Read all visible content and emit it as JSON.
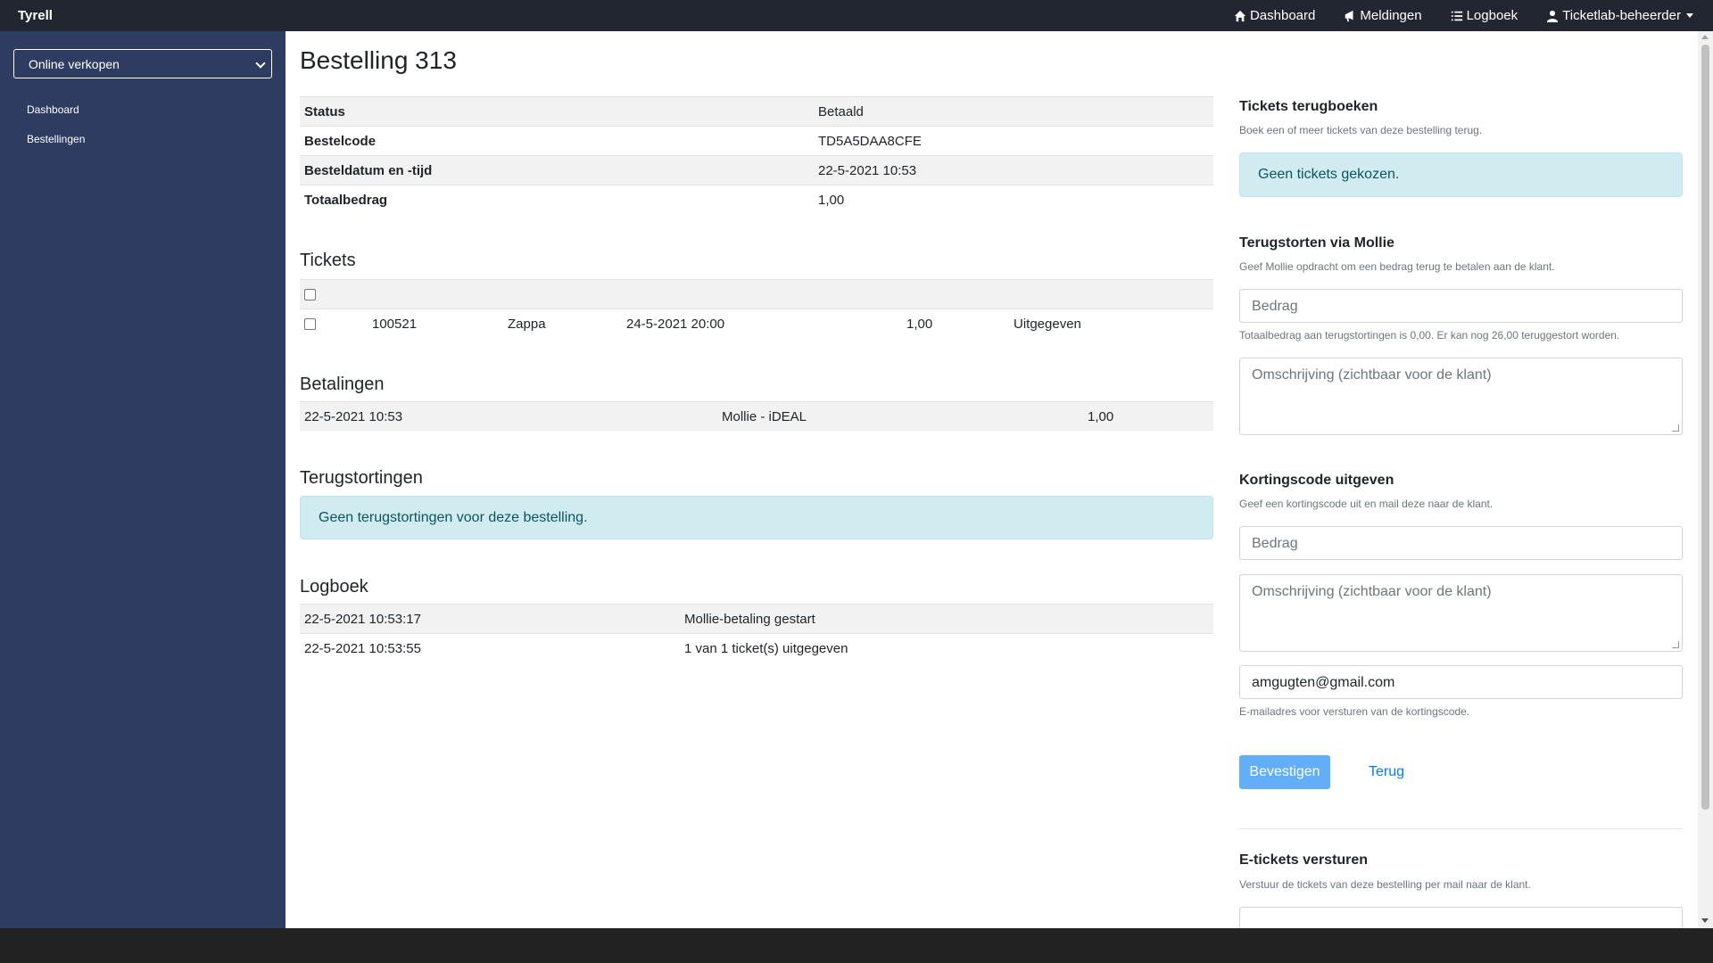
{
  "navbar": {
    "brand": "Tyrell",
    "links": [
      {
        "label": "Dashboard",
        "icon": "home-icon"
      },
      {
        "label": "Meldingen",
        "icon": "bullhorn-icon"
      },
      {
        "label": "Logboek",
        "icon": "list-icon"
      },
      {
        "label": "Ticketlab-beheerder",
        "icon": "user-icon"
      }
    ]
  },
  "sidebar": {
    "select_value": "Online verkopen",
    "items": [
      "Dashboard",
      "Bestellingen"
    ]
  },
  "page": {
    "title": "Bestelling 313"
  },
  "order_info": [
    {
      "label": "Status",
      "value": "Betaald"
    },
    {
      "label": "Bestelcode",
      "value": "TD5A5DAA8CFE"
    },
    {
      "label": "Besteldatum en -tijd",
      "value": "22-5-2021 10:53"
    },
    {
      "label": "Totaalbedrag",
      "value": "1,00"
    }
  ],
  "tickets": {
    "title": "Tickets",
    "rows": [
      {
        "id": "100521",
        "name": "Zappa",
        "date": "24-5-2021 20:00",
        "amount": "1,00",
        "status": "Uitgegeven"
      }
    ]
  },
  "payments": {
    "title": "Betalingen",
    "rows": [
      {
        "date": "22-5-2021 10:53",
        "method": "Mollie - iDEAL",
        "amount": "1,00"
      }
    ]
  },
  "refunds": {
    "title": "Terugstortingen",
    "empty": "Geen terugstortingen voor deze bestelling."
  },
  "log": {
    "title": "Logboek",
    "rows": [
      {
        "time": "22-5-2021 10:53:17",
        "message": "Mollie-betaling gestart"
      },
      {
        "time": "22-5-2021 10:53:55",
        "message": "1 van 1 ticket(s) uitgegeven"
      }
    ]
  },
  "rebook": {
    "title": "Tickets terugboeken",
    "subtitle": "Boek een of meer tickets van deze bestelling terug.",
    "empty": "Geen tickets gekozen."
  },
  "mollie_refund": {
    "title": "Terugstorten via Mollie",
    "subtitle": "Geef Mollie opdracht om een bedrag terug te betalen aan de klant.",
    "amount_placeholder": "Bedrag",
    "help": "Totaalbedrag aan terugstortingen is 0,00. Er kan nog 26,00 teruggestort worden.",
    "description_placeholder": "Omschrijving (zichtbaar voor de klant)"
  },
  "discount": {
    "title": "Kortingscode uitgeven",
    "subtitle": "Geef een kortingscode uit en mail deze naar de klant.",
    "amount_placeholder": "Bedrag",
    "description_placeholder": "Omschrijving (zichtbaar voor de klant)",
    "email_value": "amgugten@gmail.com",
    "email_help": "E-mailadres voor versturen van de kortingscode.",
    "confirm_label": "Bevestigen",
    "back_label": "Terug"
  },
  "eticket": {
    "title": "E-tickets versturen",
    "subtitle": "Verstuur de tickets van deze bestelling per mail naar de klant."
  },
  "colors": {
    "navbar": "#212631",
    "sidebar": "#2e3c62",
    "primary": "#62aef7",
    "alert_bg": "#d1ecf1",
    "alert_text": "#0c5460"
  }
}
